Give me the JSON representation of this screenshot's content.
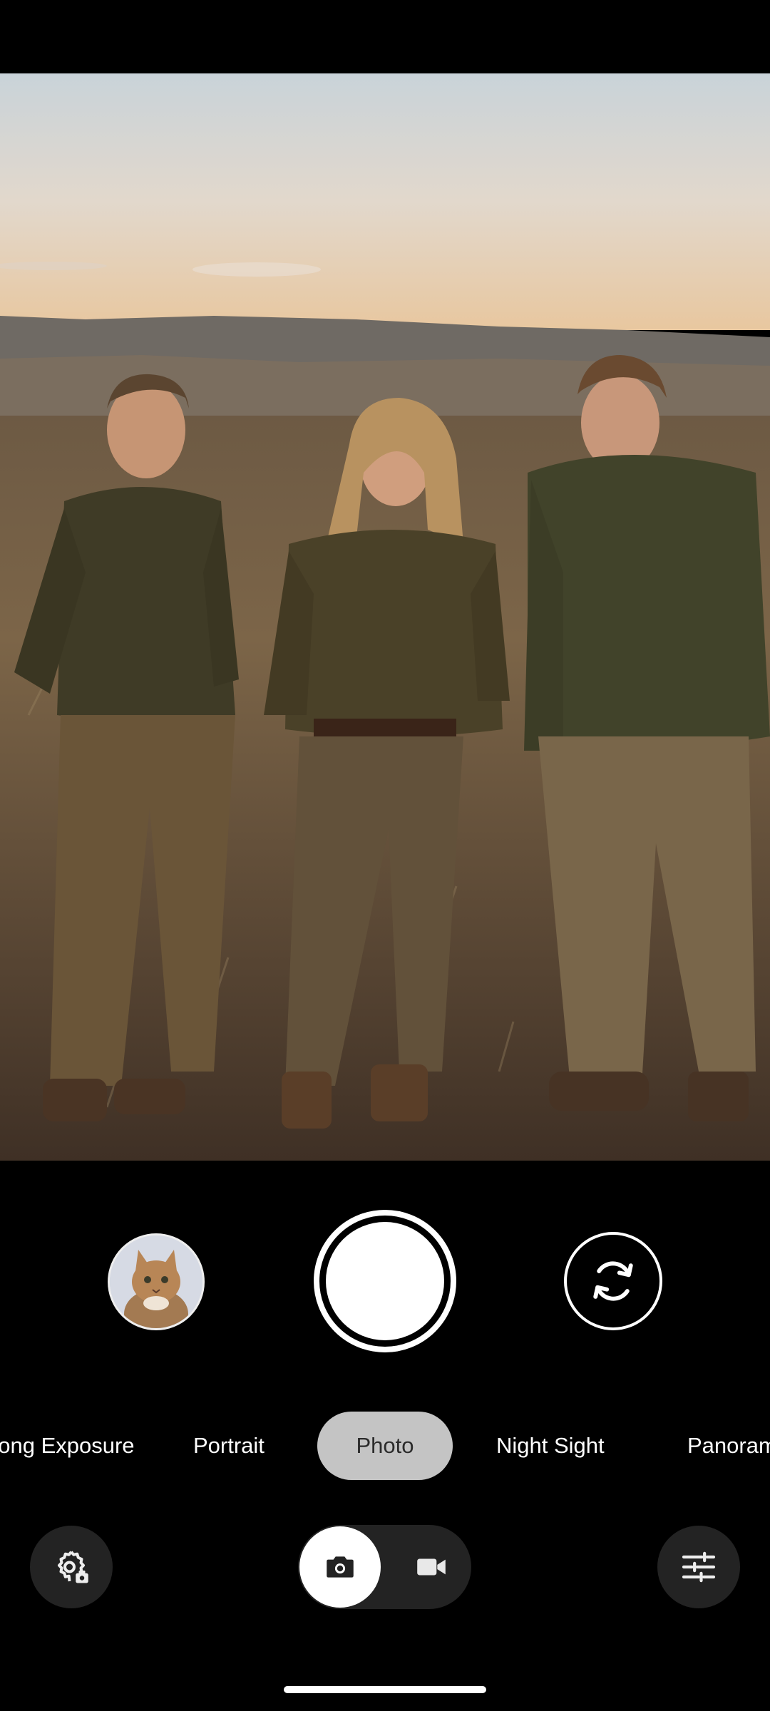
{
  "viewfinder": {
    "scene": "camera-preview"
  },
  "controls": {
    "thumbnail_icon": "last-photo-thumbnail",
    "shutter_icon": "shutter-button",
    "flip_icon": "switch-camera-icon"
  },
  "modes": [
    {
      "label": "Long Exposure",
      "active": false
    },
    {
      "label": "Portrait",
      "active": false
    },
    {
      "label": "Photo",
      "active": true
    },
    {
      "label": "Night Sight",
      "active": false
    },
    {
      "label": "Panorama",
      "active": false
    }
  ],
  "bottom_bar": {
    "settings_icon": "settings-gear-icon",
    "photo_mode_icon": "camera-icon",
    "video_mode_icon": "video-camera-icon",
    "adjust_icon": "sliders-icon"
  },
  "colors": {
    "active_mode_bg": "#c4c4c4",
    "button_bg": "#232323"
  }
}
